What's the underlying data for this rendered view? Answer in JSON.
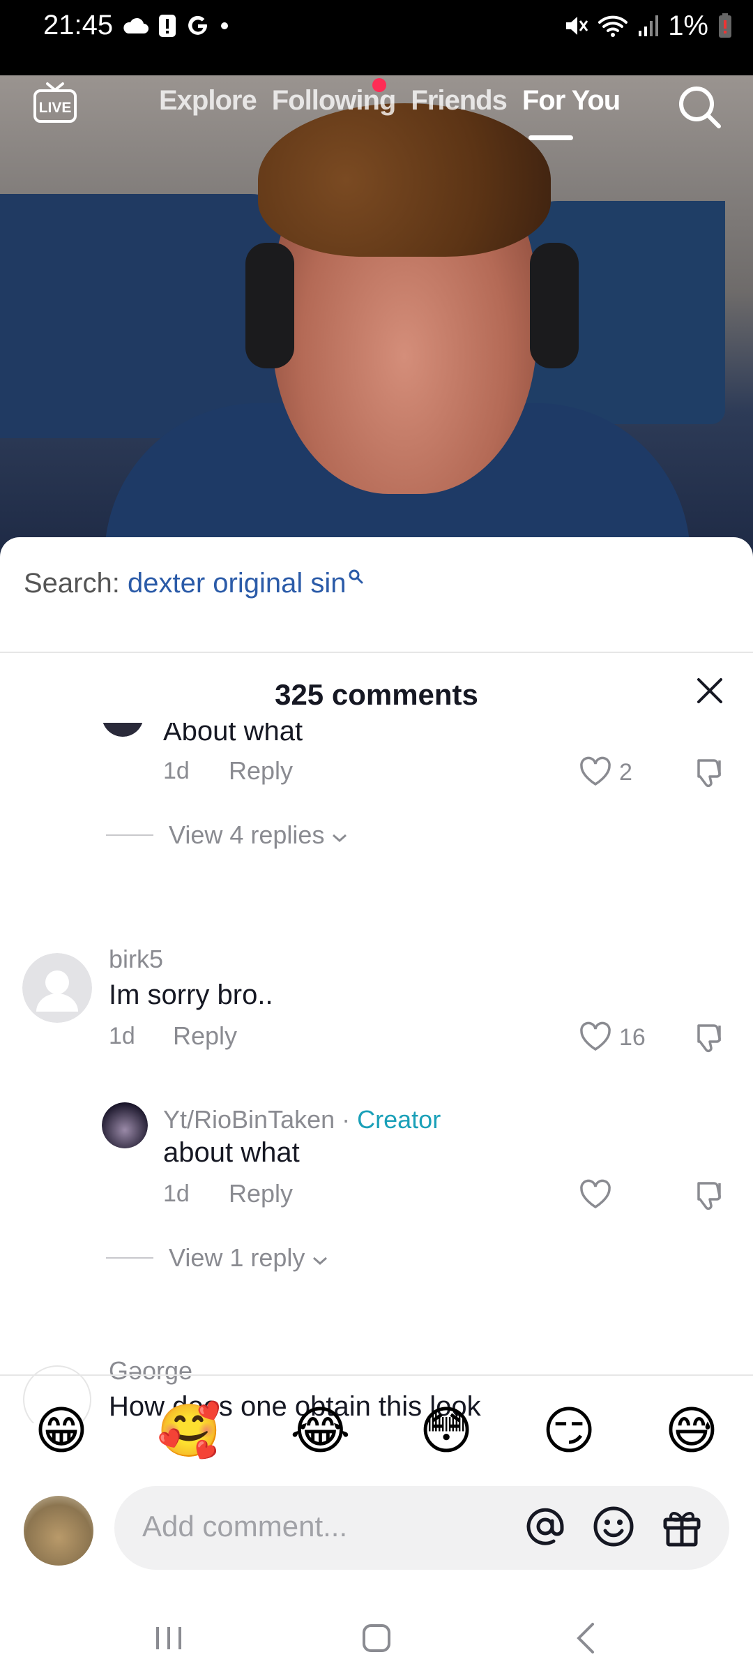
{
  "status": {
    "time": "21:45",
    "battery": "1%"
  },
  "nav": {
    "tabs": [
      {
        "label": "Explore"
      },
      {
        "label": "Following"
      },
      {
        "label": "Friends"
      },
      {
        "label": "For You"
      }
    ],
    "live_label": "LIVE"
  },
  "search_suggestion": {
    "prefix": "Search: ",
    "query": "dexter original sin"
  },
  "comments_header": {
    "title": "325 comments"
  },
  "comments": {
    "partial_reply": {
      "text": "About what",
      "age": "1d",
      "reply_label": "Reply",
      "likes": "2",
      "view_replies": "View 4 replies"
    },
    "birk": {
      "username": "birk5",
      "text": "Im sorry bro..",
      "age": "1d",
      "reply_label": "Reply",
      "likes": "16"
    },
    "creator_reply": {
      "username": "Yt/RioBinTaken",
      "separator": " · ",
      "creator_label": "Creator",
      "text": "about what",
      "age": "1d",
      "reply_label": "Reply",
      "view_replies": "View 1 reply"
    },
    "george": {
      "username": "Gəorge",
      "text": "How does one obtain this look"
    }
  },
  "emoji_bar": [
    "😁",
    "🥰",
    "😂",
    "😳",
    "😏",
    "😅"
  ],
  "comment_input": {
    "placeholder": "Add comment..."
  },
  "colors": {
    "accent_blue": "#2b5ba8",
    "creator_teal": "#1aa0b8",
    "notification_red": "#fe2c55"
  }
}
